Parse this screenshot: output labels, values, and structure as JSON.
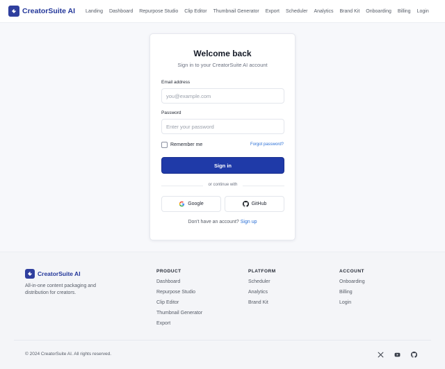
{
  "brand": {
    "name": "CreatorSuite AI"
  },
  "nav": [
    "Landing",
    "Dashboard",
    "Repurpose Studio",
    "Clip Editor",
    "Thumbnail Generator",
    "Export",
    "Scheduler",
    "Analytics",
    "Brand Kit",
    "Onboarding",
    "Billing",
    "Login"
  ],
  "login": {
    "title": "Welcome back",
    "subtitle": "Sign in to your CreatorSuite AI account",
    "email_label": "Email address",
    "email_placeholder": "you@example.com",
    "password_label": "Password",
    "password_placeholder": "Enter your password",
    "remember_label": "Remember me",
    "forgot_label": "Forgot password?",
    "submit_label": "Sign in",
    "divider_text": "or continue with",
    "google_label": "Google",
    "github_label": "GitHub",
    "no_account_text": "Don't have an account?",
    "signup_label": "Sign up"
  },
  "footer": {
    "brand_name": "CreatorSuite AI",
    "description": "All-in-one content packaging and distribution for creators.",
    "columns": [
      {
        "title": "PRODUCT",
        "links": [
          "Dashboard",
          "Repurpose Studio",
          "Clip Editor",
          "Thumbnail Generator",
          "Export"
        ]
      },
      {
        "title": "PLATFORM",
        "links": [
          "Scheduler",
          "Analytics",
          "Brand Kit"
        ]
      },
      {
        "title": "ACCOUNT",
        "links": [
          "Onboarding",
          "Billing",
          "Login"
        ]
      }
    ],
    "copyright": "© 2024 CreatorSuite AI. All rights reserved.",
    "social_icons": [
      "x-icon",
      "youtube-icon",
      "github-icon"
    ]
  },
  "colors": {
    "brand": "#23379a",
    "primary_button": "#1f3aa8",
    "link": "#2a6fd6"
  }
}
